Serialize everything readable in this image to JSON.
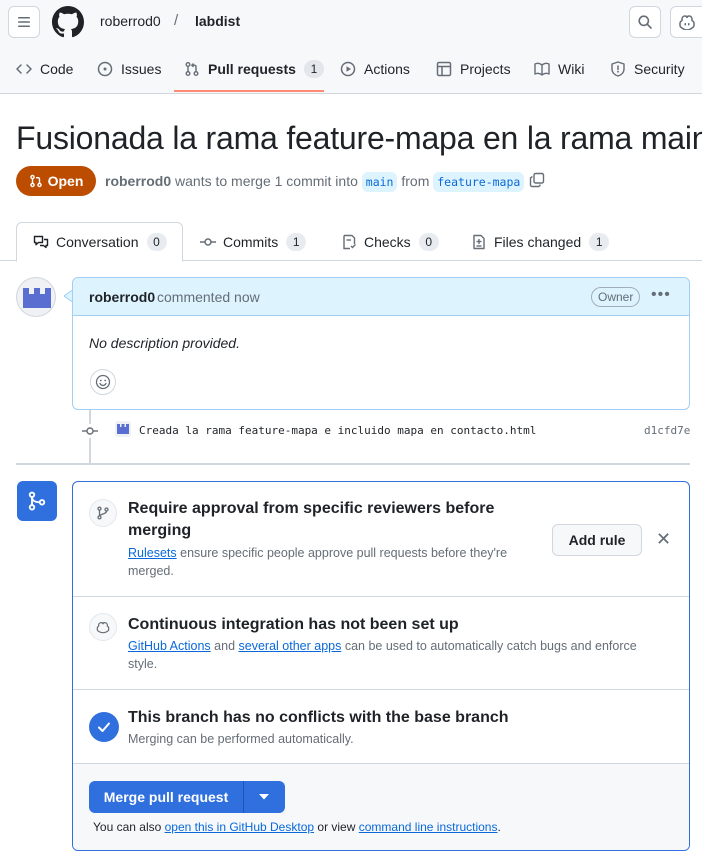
{
  "header": {
    "owner": "roberrod0",
    "separator": "/",
    "repo": "labdist"
  },
  "nav": {
    "items": [
      {
        "label": "Code",
        "icon": "code-icon"
      },
      {
        "label": "Issues",
        "icon": "issue-icon"
      },
      {
        "label": "Pull requests",
        "icon": "pull-request-icon",
        "count": "1",
        "active": true
      },
      {
        "label": "Actions",
        "icon": "play-icon"
      },
      {
        "label": "Projects",
        "icon": "table-icon"
      },
      {
        "label": "Wiki",
        "icon": "book-icon"
      },
      {
        "label": "Security",
        "icon": "shield-icon"
      }
    ]
  },
  "pr": {
    "title": "Fusionada la rama feature-mapa en la rama main",
    "state": "Open",
    "author": "roberrod0",
    "meta_text": "wants to merge 1 commit into",
    "base_branch": "main",
    "from_text": "from",
    "head_branch": "feature-mapa"
  },
  "tabs": [
    {
      "label": "Conversation",
      "count": "0"
    },
    {
      "label": "Commits",
      "count": "1"
    },
    {
      "label": "Checks",
      "count": "0"
    },
    {
      "label": "Files changed",
      "count": "1"
    }
  ],
  "comment": {
    "author": "roberrod0",
    "when": "commented now",
    "badge": "Owner",
    "body": "No description provided."
  },
  "commit": {
    "message": "Creada la rama feature-mapa e incluido mapa en contacto.html",
    "sha": "d1cfd7e"
  },
  "merge_box": {
    "reviewers": {
      "title": "Require approval from specific reviewers before merging",
      "link": "Rulesets",
      "desc": "ensure specific people approve pull requests before they're merged.",
      "button": "Add rule"
    },
    "ci": {
      "title": "Continuous integration has not been set up",
      "link1": "GitHub Actions",
      "and": "and",
      "link2": "several other apps",
      "desc": "can be used to automatically catch bugs and enforce style."
    },
    "conflicts": {
      "title": "This branch has no conflicts with the base branch",
      "desc": "Merging can be performed automatically."
    },
    "merge_button": "Merge pull request",
    "also_prefix": "You can also",
    "also_link1": "open this in GitHub Desktop",
    "also_middle": "or view",
    "also_link2": "command line instructions",
    "also_suffix": "."
  },
  "colors": {
    "accent": "#2f6fde",
    "open_state": "#bc4c00",
    "link": "#0969da"
  }
}
